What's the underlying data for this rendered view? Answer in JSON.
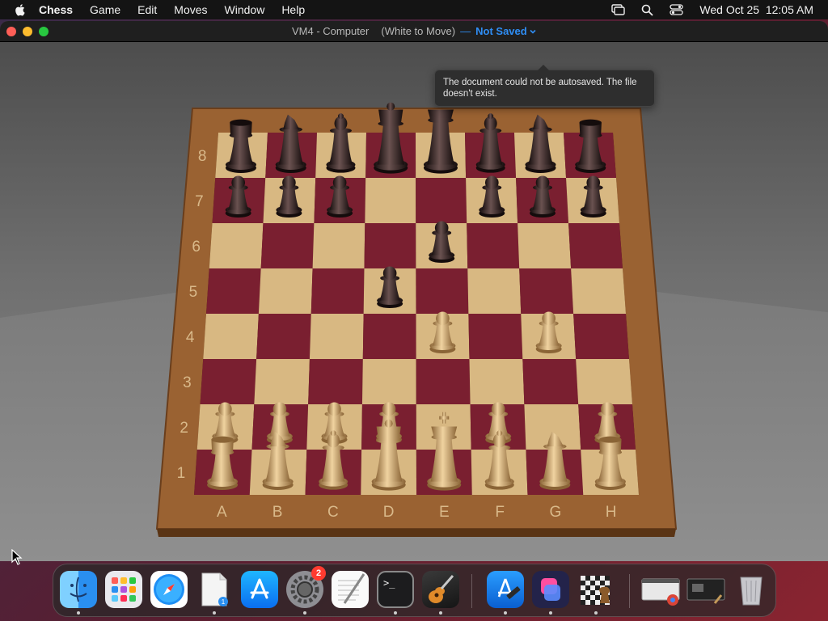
{
  "menubar": {
    "app_name": "Chess",
    "items": [
      "Game",
      "Edit",
      "Moves",
      "Window",
      "Help"
    ],
    "clock": "Wed Oct 25  12:05 AM"
  },
  "window": {
    "title": "VM4 - Computer",
    "status": "(White to Move)",
    "separator": "—",
    "save_state": "Not Saved"
  },
  "tooltip": {
    "text": "The document could not be autosaved. The file doesn't exist."
  },
  "board": {
    "files": [
      "A",
      "B",
      "C",
      "D",
      "E",
      "F",
      "G",
      "H"
    ],
    "ranks": [
      "8",
      "7",
      "6",
      "5",
      "4",
      "3",
      "2",
      "1"
    ],
    "light_square": "#d8b882",
    "dark_square": "#7a1f30",
    "frame": "#9a6232",
    "pieces": [
      {
        "square": "a8",
        "color": "black",
        "type": "rook"
      },
      {
        "square": "b8",
        "color": "black",
        "type": "knight"
      },
      {
        "square": "c8",
        "color": "black",
        "type": "bishop"
      },
      {
        "square": "d8",
        "color": "black",
        "type": "queen"
      },
      {
        "square": "e8",
        "color": "black",
        "type": "king"
      },
      {
        "square": "f8",
        "color": "black",
        "type": "bishop"
      },
      {
        "square": "g8",
        "color": "black",
        "type": "knight"
      },
      {
        "square": "h8",
        "color": "black",
        "type": "rook"
      },
      {
        "square": "a7",
        "color": "black",
        "type": "pawn"
      },
      {
        "square": "b7",
        "color": "black",
        "type": "pawn"
      },
      {
        "square": "c7",
        "color": "black",
        "type": "pawn"
      },
      {
        "square": "f7",
        "color": "black",
        "type": "pawn"
      },
      {
        "square": "g7",
        "color": "black",
        "type": "pawn"
      },
      {
        "square": "h7",
        "color": "black",
        "type": "pawn"
      },
      {
        "square": "e6",
        "color": "black",
        "type": "pawn"
      },
      {
        "square": "d5",
        "color": "black",
        "type": "pawn"
      },
      {
        "square": "e4",
        "color": "white",
        "type": "pawn"
      },
      {
        "square": "g4",
        "color": "white",
        "type": "pawn"
      },
      {
        "square": "a2",
        "color": "white",
        "type": "pawn"
      },
      {
        "square": "b2",
        "color": "white",
        "type": "pawn"
      },
      {
        "square": "c2",
        "color": "white",
        "type": "pawn"
      },
      {
        "square": "d2",
        "color": "white",
        "type": "pawn"
      },
      {
        "square": "f2",
        "color": "white",
        "type": "pawn"
      },
      {
        "square": "h2",
        "color": "white",
        "type": "pawn"
      },
      {
        "square": "a1",
        "color": "white",
        "type": "rook"
      },
      {
        "square": "b1",
        "color": "white",
        "type": "knight"
      },
      {
        "square": "c1",
        "color": "white",
        "type": "bishop"
      },
      {
        "square": "d1",
        "color": "white",
        "type": "queen"
      },
      {
        "square": "e1",
        "color": "white",
        "type": "king"
      },
      {
        "square": "f1",
        "color": "white",
        "type": "bishop"
      },
      {
        "square": "g1",
        "color": "white",
        "type": "knight"
      },
      {
        "square": "h1",
        "color": "white",
        "type": "rook"
      }
    ]
  },
  "dock": {
    "items": [
      {
        "name": "finder-icon",
        "running": true
      },
      {
        "name": "launchpad-icon",
        "running": false
      },
      {
        "name": "safari-icon",
        "running": false
      },
      {
        "name": "document-icon",
        "running": true,
        "badge": "1"
      },
      {
        "name": "app-store-icon",
        "running": false
      },
      {
        "name": "system-settings-icon",
        "running": true,
        "badge": "2"
      },
      {
        "name": "textedit-icon",
        "running": false
      },
      {
        "name": "terminal-icon",
        "running": true
      },
      {
        "name": "garageband-icon",
        "running": true
      },
      {
        "name": "xcode-icon",
        "running": true
      },
      {
        "name": "shortcuts-icon",
        "running": true
      },
      {
        "name": "chess-icon",
        "running": true
      },
      {
        "name": "chrome-window-icon",
        "running": false
      },
      {
        "name": "preview-window-icon",
        "running": false
      },
      {
        "name": "trash-icon",
        "running": false
      }
    ]
  }
}
